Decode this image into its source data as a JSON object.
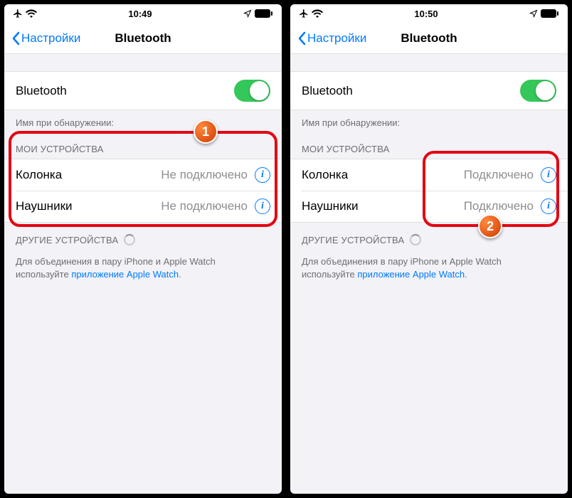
{
  "screens": [
    {
      "statusbar": {
        "time": "10:49"
      },
      "nav": {
        "back": "Настройки",
        "title": "Bluetooth"
      },
      "toggle": {
        "label": "Bluetooth",
        "on": true
      },
      "discovery_label": "Имя при обнаружении:",
      "my_devices_header": "МОИ УСТРОЙСТВА",
      "devices": [
        {
          "name": "Колонка",
          "status": "Не подключено"
        },
        {
          "name": "Наушники",
          "status": "Не подключено"
        }
      ],
      "other_header": "ДРУГИЕ УСТРОЙСТВА",
      "footer_pre": "Для объединения в пару iPhone и Apple Watch используйте ",
      "footer_link": "приложение Apple Watch",
      "footer_post": ".",
      "badge": "1"
    },
    {
      "statusbar": {
        "time": "10:50"
      },
      "nav": {
        "back": "Настройки",
        "title": "Bluetooth"
      },
      "toggle": {
        "label": "Bluetooth",
        "on": true
      },
      "discovery_label": "Имя при обнаружении:",
      "my_devices_header": "МОИ УСТРОЙСТВА",
      "devices": [
        {
          "name": "Колонка",
          "status": "Подключено"
        },
        {
          "name": "Наушники",
          "status": "Подключено"
        }
      ],
      "other_header": "ДРУГИЕ УСТРОЙСТВА",
      "footer_pre": "Для объединения в пару iPhone и Apple Watch используйте ",
      "footer_link": "приложение Apple Watch",
      "footer_post": ".",
      "badge": "2"
    }
  ]
}
